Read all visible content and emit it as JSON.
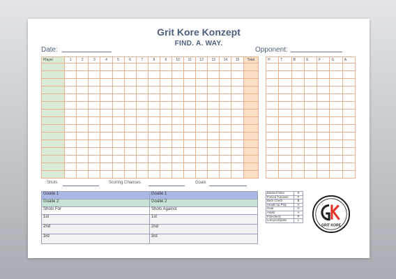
{
  "header": {
    "title": "Grit Kore Konzept",
    "tagline": "FIND. A. WAY.",
    "date_label": "Date:",
    "opponent_label": "Opponent:"
  },
  "grid": {
    "player_label": "Player",
    "periods": [
      "1",
      "2",
      "3",
      "4",
      "5",
      "6",
      "7",
      "8",
      "9",
      "10",
      "11",
      "12",
      "13",
      "14",
      "15"
    ],
    "total_label": "Total",
    "rows": 15
  },
  "side_grid": {
    "headers": [
      "H",
      "T",
      "B",
      "S",
      "F",
      "G",
      "A"
    ]
  },
  "summary": {
    "shots_label": "Shots",
    "scoring_label": "Scoring Chances",
    "goals_label": "Goals"
  },
  "goalies": {
    "row1": [
      "Goalie 1",
      "Goalie 1"
    ],
    "row2": [
      "Goalie 2",
      "Goalie 2"
    ],
    "row3": [
      "Shots For",
      "Shots Against"
    ],
    "periods": [
      [
        "1st",
        "1st"
      ],
      [
        "2nd",
        "2nd"
      ],
      [
        "3rd",
        "3rd"
      ]
    ]
  },
  "stat_legend": [
    {
      "label": "Blocked Shot",
      "key": "S"
    },
    {
      "label": "Forced Turnover",
      "key": "F"
    },
    {
      "label": "Back Check",
      "key": "B"
    },
    {
      "label": "Heads Up Play",
      "key": "H"
    },
    {
      "label": "Goal",
      "key": "G"
    },
    {
      "label": "Assist",
      "key": "A"
    },
    {
      "label": "Forecheck",
      "key": "P"
    },
    {
      "label": "Lost puck/pass",
      "key": "L"
    }
  ],
  "logo": {
    "letters": "GK",
    "text": "GRIT KORE",
    "colors": {
      "dark": "#1f1f1f",
      "accent": "#e0342b"
    }
  }
}
